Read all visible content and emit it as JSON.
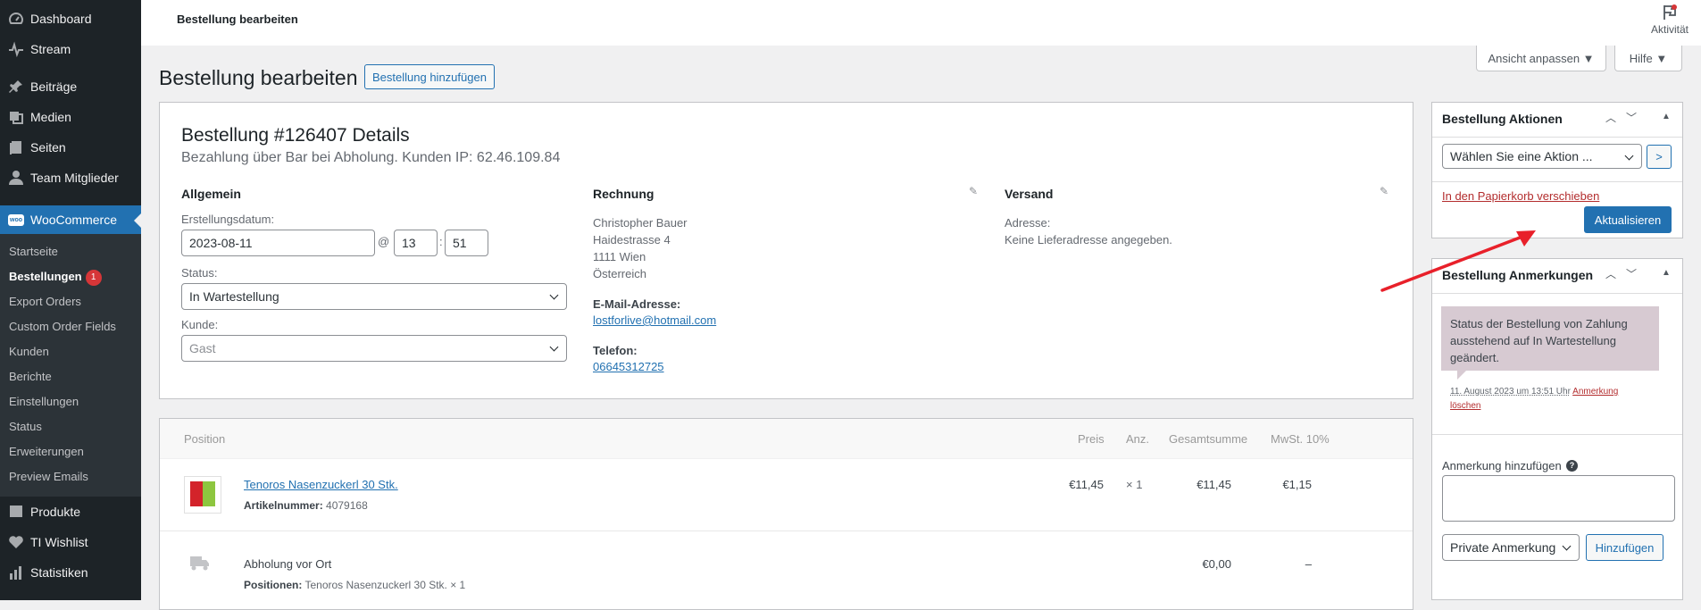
{
  "sidebar": {
    "top_items": [
      {
        "label": "Dashboard",
        "icon": "dashboard-icon"
      },
      {
        "label": "Stream",
        "icon": "stream-icon"
      },
      {
        "label": "Beiträge",
        "icon": "pin-icon"
      },
      {
        "label": "Medien",
        "icon": "media-icon"
      },
      {
        "label": "Seiten",
        "icon": "pages-icon"
      },
      {
        "label": "Team Mitglieder",
        "icon": "user-icon"
      }
    ],
    "woocommerce": {
      "label": "WooCommerce",
      "icon_text": "woo"
    },
    "submenu": [
      "Startseite",
      "Bestellungen",
      "Export Orders",
      "Custom Order Fields",
      "Kunden",
      "Berichte",
      "Einstellungen",
      "Status",
      "Erweiterungen",
      "Preview Emails"
    ],
    "orders_badge": "1",
    "bottom_items": [
      {
        "label": "Produkte",
        "icon": "products-icon"
      },
      {
        "label": "TI Wishlist",
        "icon": "heart-icon"
      },
      {
        "label": "Statistiken",
        "icon": "stats-icon"
      }
    ]
  },
  "topbar": {
    "title": "Bestellung bearbeiten",
    "activity": "Aktivität"
  },
  "screen_options": {
    "customize": "Ansicht anpassen ▼",
    "help": "Hilfe ▼"
  },
  "heading": {
    "title": "Bestellung bearbeiten",
    "add_button": "Bestellung hinzufügen"
  },
  "order": {
    "title": "Bestellung #126407 Details",
    "subtitle": "Bezahlung über Bar bei Abholung. Kunden IP: 62.46.109.84",
    "general": {
      "title": "Allgemein",
      "date_label": "Erstellungsdatum:",
      "date": "2023-08-11",
      "at": "@",
      "hour": "13",
      "colon": ":",
      "minute": "51",
      "status_label": "Status:",
      "status": "In Wartestellung",
      "customer_label": "Kunde:",
      "customer": "Gast"
    },
    "billing": {
      "title": "Rechnung",
      "address": [
        "Christopher Bauer",
        "Haidestrasse 4",
        "1111 Wien",
        "Österreich"
      ],
      "email_label": "E-Mail-Adresse:",
      "email": "lostforlive@hotmail.com",
      "phone_label": "Telefon:",
      "phone": "06645312725"
    },
    "shipping": {
      "title": "Versand",
      "address_label": "Adresse:",
      "address": "Keine Lieferadresse angegeben."
    }
  },
  "items": {
    "headers": {
      "position": "Position",
      "price": "Preis",
      "qty": "Anz.",
      "total": "Gesamtsumme",
      "tax": "MwSt. 10%"
    },
    "product": {
      "name": "Tenoros Nasenzuckerl 30 Stk.",
      "sku_label": "Artikelnummer:",
      "sku": "4079168",
      "price": "€11,45",
      "qty": "× 1",
      "total": "€11,45",
      "tax": "€1,15"
    },
    "shipping": {
      "name": "Abholung vor Ort",
      "positions_label": "Positionen:",
      "positions": "Tenoros Nasenzuckerl 30 Stk. × 1",
      "total": "€0,00",
      "tax": "–"
    }
  },
  "actions": {
    "title": "Bestellung Aktionen",
    "select": "Wählen Sie eine Aktion ...",
    "go": ">",
    "trash": "In den Papierkorb verschieben",
    "update": "Aktualisieren"
  },
  "notes": {
    "title": "Bestellung Anmerkungen",
    "note_text": "Status der Bestellung von Zahlung ausstehend auf In Wartestellung geändert.",
    "meta": "11. August 2023 um 13:51 Uhr",
    "delete_1": "Anmerkung",
    "delete_2": "löschen",
    "add_label": "Anmerkung hinzufügen",
    "help": "?",
    "type": "Private Anmerkung",
    "add_button": "Hinzufügen"
  },
  "colors": {
    "accent": "#2271b1",
    "sidebar": "#1d2327",
    "note": "#d7cad2",
    "arrow": "#e8202a",
    "danger": "#b32d2e"
  }
}
